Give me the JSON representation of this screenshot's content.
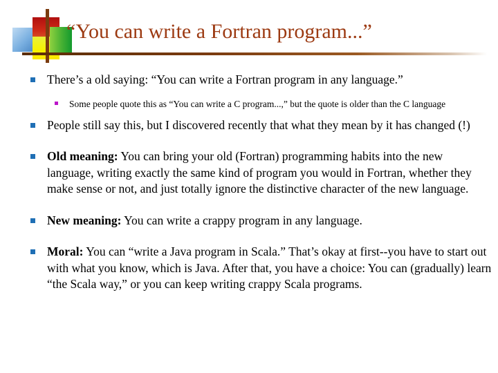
{
  "slide": {
    "title": "“You can write a Fortran program...”",
    "decoration": {
      "blue": "#6fa9de",
      "red": "#cf2a17",
      "yellow": "#f6f200",
      "green": "#45b033",
      "bar": "#7a3b10",
      "title_color": "#9c3a12"
    },
    "bullet_colors": {
      "level1": "#1f6fb5",
      "level2": "#bb16c9"
    },
    "bullets": [
      {
        "level": 1,
        "text": "There’s a old saying: “You can write a Fortran program in any language.”"
      },
      {
        "level": 2,
        "text": "Some people quote this as “You can write a C program...,” but the quote is older than the C language"
      },
      {
        "level": 1,
        "text": "People still say this, but I discovered recently that what they mean by it has changed (!)"
      },
      {
        "level": 1,
        "lead": "Old meaning:",
        "text": " You can bring your old (Fortran) programming habits into the new language, writing exactly the same kind of program you would in Fortran, whether they make sense or not, and just totally ignore the distinctive character of the new language."
      },
      {
        "level": 1,
        "lead": "New meaning:",
        "text": " You can write a crappy program in any language."
      },
      {
        "level": 1,
        "lead": "Moral:",
        "text": " You can “write a Java program in Scala.” That’s okay at first--you have to start out with what you know, which is Java. After that, you have a choice: You can (gradually) learn “the Scala way,” or you can keep writing crappy Scala programs."
      }
    ]
  }
}
